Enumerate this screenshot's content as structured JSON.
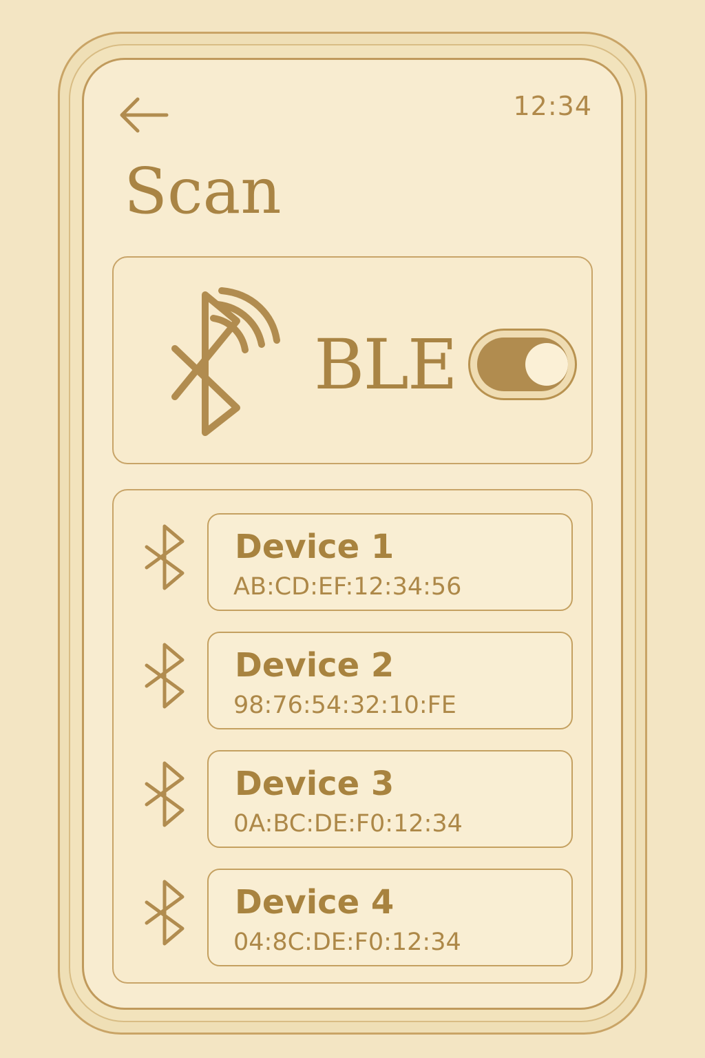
{
  "status_bar": {
    "time": "12:34"
  },
  "header": {
    "back_icon": "arrow-left-icon",
    "title": "Scan"
  },
  "ble_panel": {
    "icon": "bluetooth-signal-icon",
    "label": "BLE",
    "toggle_state": "on"
  },
  "devices": [
    {
      "name": "Device 1",
      "mac": "AB:CD:EF:12:34:56",
      "icon": "bluetooth-icon"
    },
    {
      "name": "Device 2",
      "mac": "98:76:54:32:10:FE",
      "icon": "bluetooth-icon"
    },
    {
      "name": "Device 3",
      "mac": "0A:BC:DE:F0:12:34",
      "icon": "bluetooth-icon"
    },
    {
      "name": "Device 4",
      "mac": "04:8C:DE:F0:12:34",
      "icon": "bluetooth-icon"
    }
  ],
  "colors": {
    "background": "#f3e5c3",
    "screen": "#f8ecd0",
    "accent": "#a98444",
    "border": "#c8a468"
  }
}
